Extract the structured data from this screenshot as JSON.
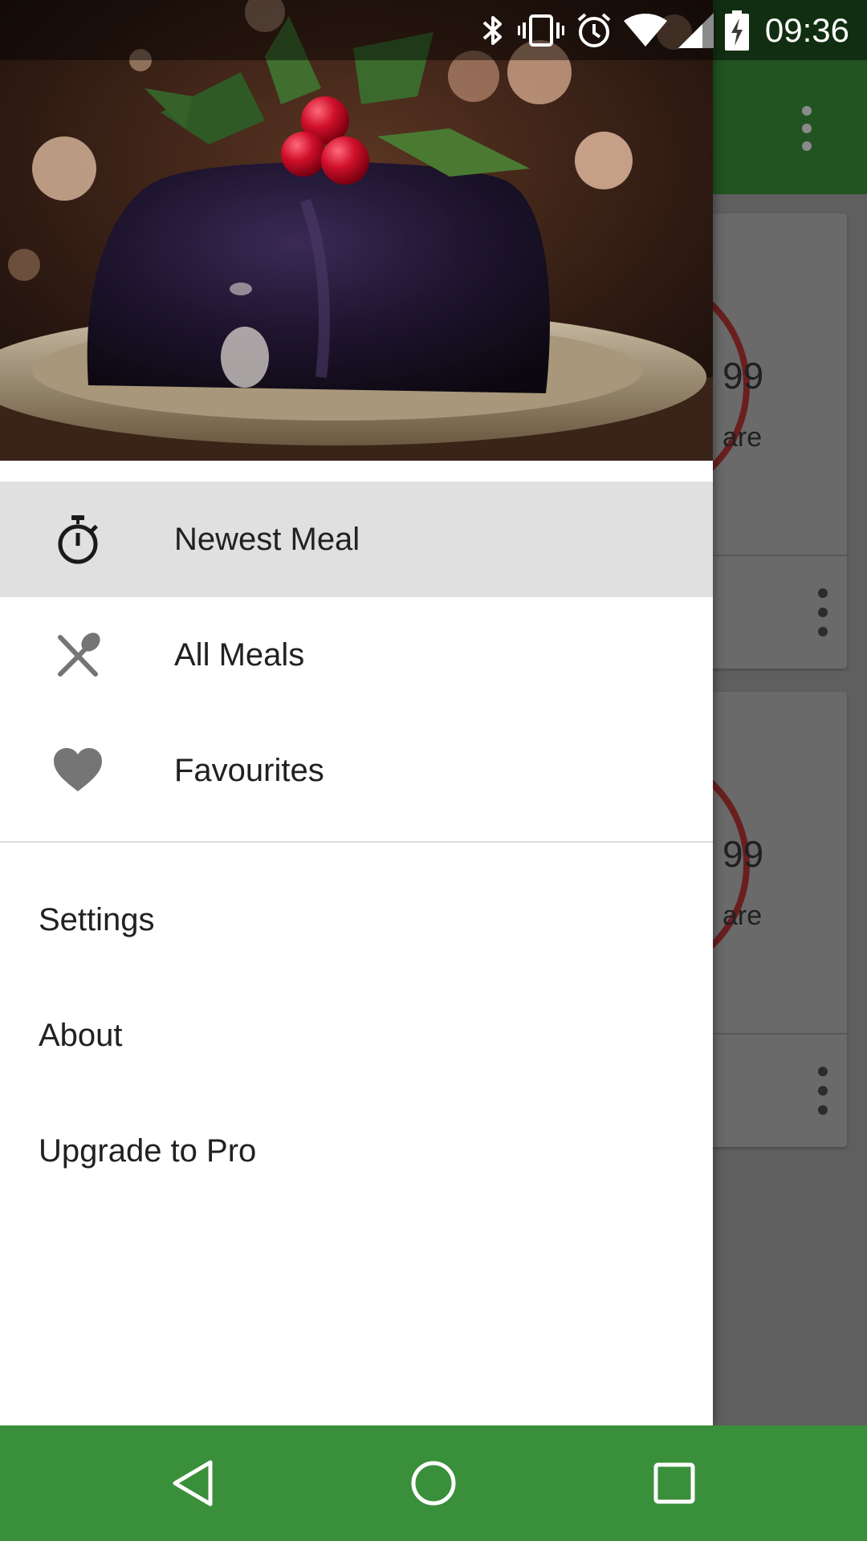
{
  "status_bar": {
    "time": "09:36",
    "icons": [
      "bluetooth-icon",
      "vibrate-icon",
      "alarm-icon",
      "wifi-icon",
      "signal-icon",
      "battery-charging-icon"
    ]
  },
  "background_app": {
    "toolbar_color": "#215421",
    "cards": [
      {
        "ring_number": "99",
        "ring_label": "are"
      },
      {
        "ring_number": "99",
        "ring_label": "are"
      }
    ]
  },
  "drawer": {
    "header_image": "christmas-pudding-with-holly",
    "menu": [
      {
        "label": "Newest Meal",
        "icon": "stopwatch-icon",
        "active": true
      },
      {
        "label": "All Meals",
        "icon": "cutlery-icon",
        "active": false
      },
      {
        "label": "Favourites",
        "icon": "heart-icon",
        "active": false
      }
    ],
    "secondary": [
      {
        "label": "Settings"
      },
      {
        "label": "About"
      },
      {
        "label": "Upgrade to Pro"
      }
    ]
  },
  "nav_bar": {
    "color": "#3a8f3a",
    "buttons": [
      "back-icon",
      "home-icon",
      "recents-icon"
    ]
  }
}
